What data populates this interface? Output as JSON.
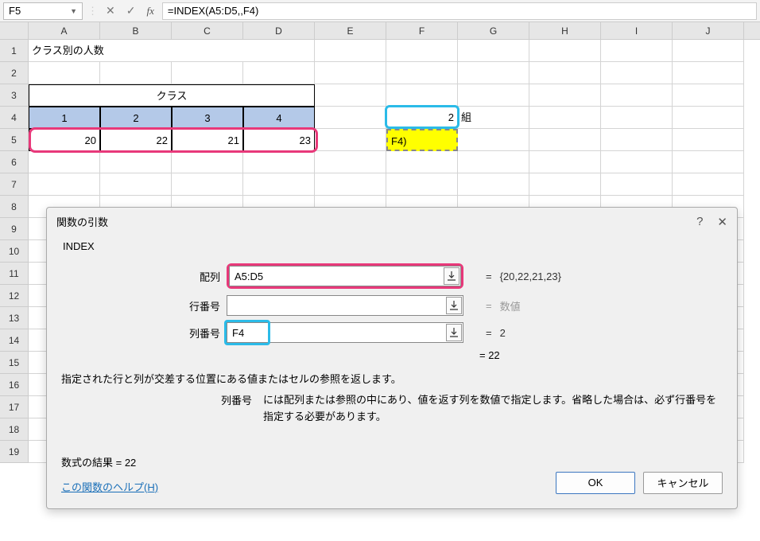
{
  "name_box": "F5",
  "formula": "=INDEX(A5:D5,,F4)",
  "columns": [
    "A",
    "B",
    "C",
    "D",
    "E",
    "F",
    "G",
    "H",
    "I",
    "J"
  ],
  "rows_shown": 19,
  "cells": {
    "A1": "クラス別の人数",
    "A3_merged": "クラス",
    "class_nums": [
      "1",
      "2",
      "3",
      "4"
    ],
    "class_vals": [
      "20",
      "22",
      "21",
      "23"
    ],
    "F4": "2",
    "G4": "組",
    "F5": "F4)"
  },
  "dialog": {
    "title": "関数の引数",
    "func_name": "INDEX",
    "args": {
      "array": {
        "label": "配列",
        "value": "A5:D5",
        "result": "{20,22,21,23}"
      },
      "row": {
        "label": "行番号",
        "value": "",
        "result": "数値"
      },
      "col": {
        "label": "列番号",
        "value": "F4",
        "result": "2"
      }
    },
    "overall_result": "= 22",
    "desc1": "指定された行と列が交差する位置にある値またはセルの参照を返します。",
    "desc2_label": "列番号",
    "desc2_text": "には配列または参照の中にあり、値を返す列を数値で指定します。省略した場合は、必ず行番号を指定する必要があります。",
    "formula_result_label": "数式の結果 = ",
    "formula_result_value": "22",
    "help_link": "この関数のヘルプ(H)",
    "ok": "OK",
    "cancel": "キャンセル"
  },
  "chart_data": {
    "type": "table",
    "title": "クラス別の人数",
    "headers": [
      "クラス1",
      "クラス2",
      "クラス3",
      "クラス4"
    ],
    "values": [
      20,
      22,
      21,
      23
    ]
  }
}
